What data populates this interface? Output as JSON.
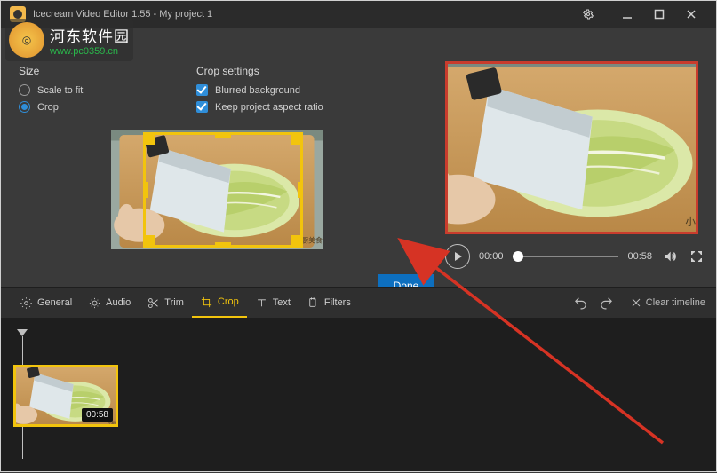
{
  "titlebar": {
    "title": "Icecream Video Editor 1.55 - My project 1"
  },
  "watermark": {
    "line1": "河东软件园",
    "line2": "www.pc0359.cn"
  },
  "panels": {
    "size_title": "Size",
    "scale_to_fit": "Scale to fit",
    "crop": "Crop",
    "crop_settings_title": "Crop settings",
    "blurred_bg": "Blurred background",
    "keep_aspect": "Keep project aspect ratio"
  },
  "buttons": {
    "done": "Done"
  },
  "player": {
    "current": "00:00",
    "total": "00:58"
  },
  "tabs": {
    "general": "General",
    "audio": "Audio",
    "trim": "Trim",
    "crop": "Crop",
    "text": "Text",
    "filters": "Filters",
    "clear": "Clear timeline"
  },
  "timeline": {
    "clip_duration": "00:58"
  }
}
